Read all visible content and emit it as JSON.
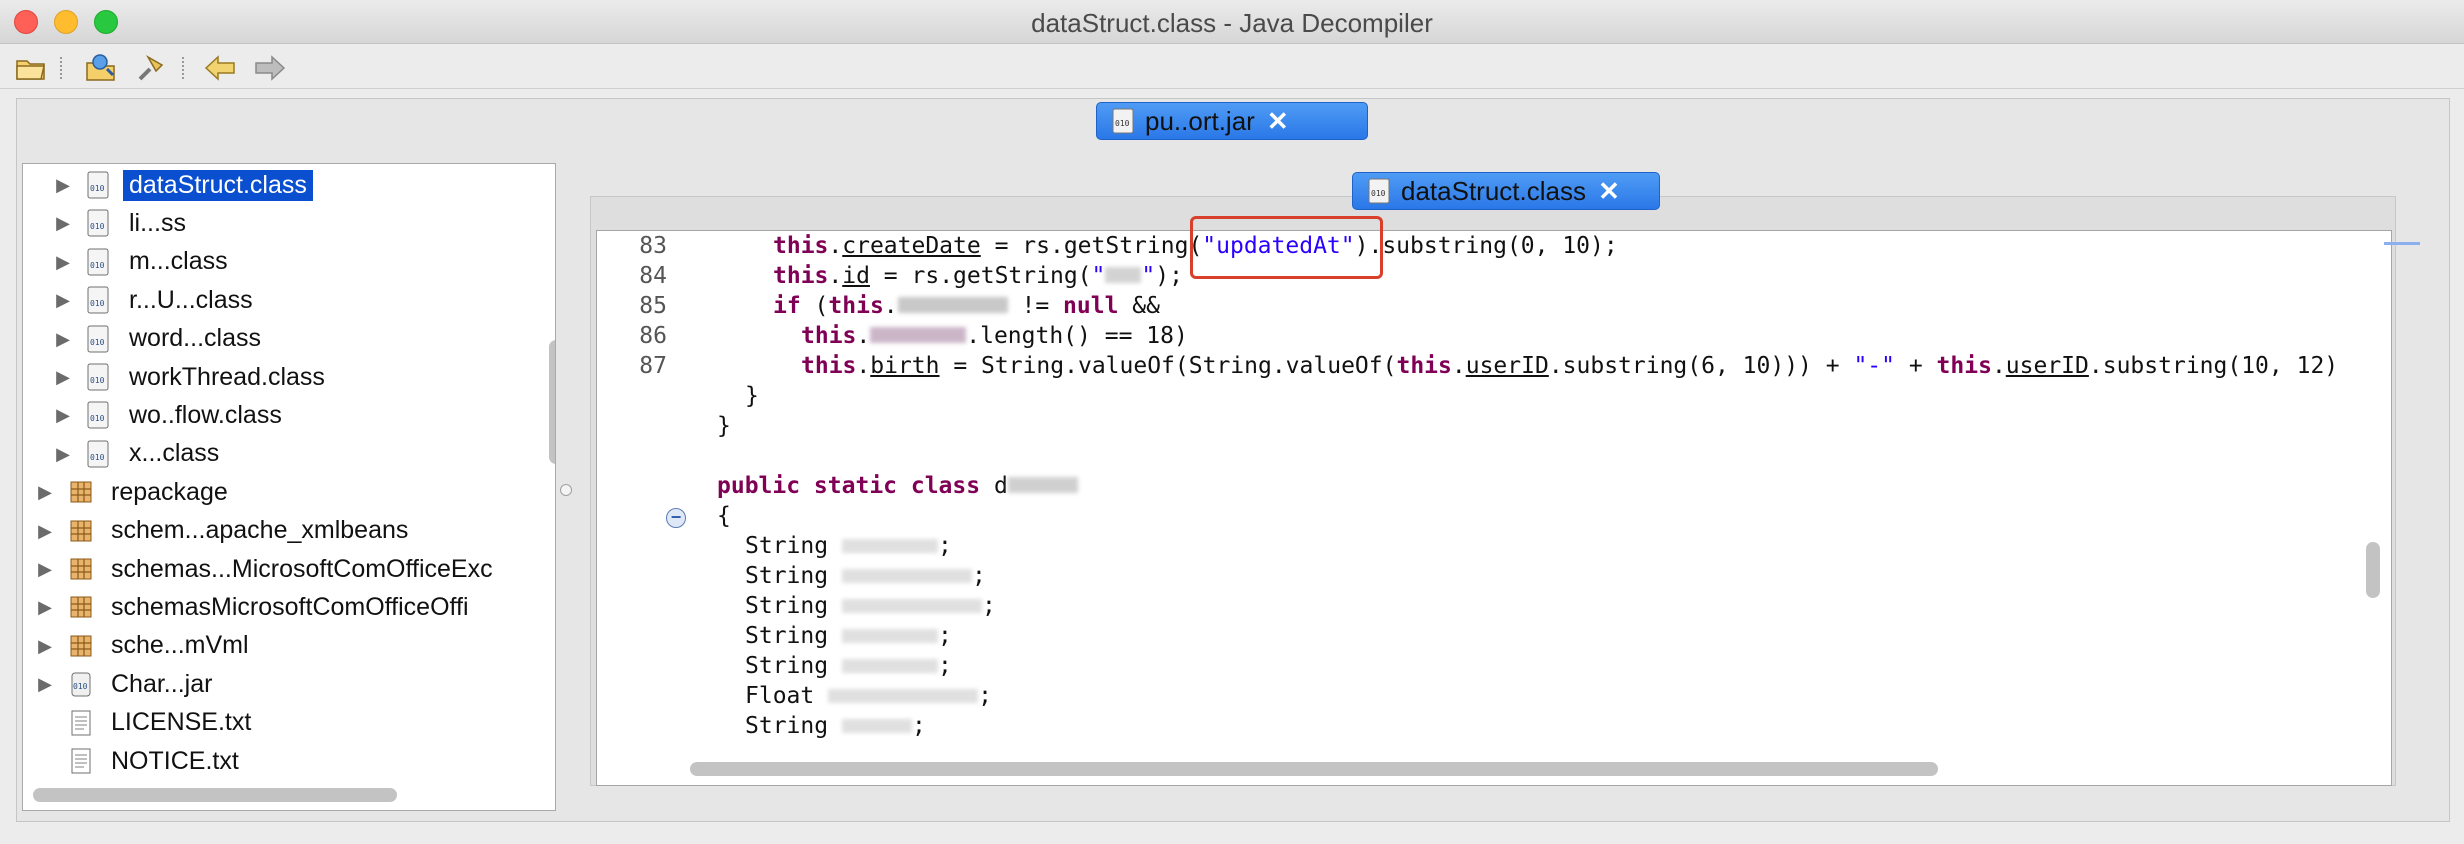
{
  "window": {
    "title": "dataStruct.class - Java Decompiler"
  },
  "toolbar": {
    "buttons": [
      {
        "name": "open-file-icon"
      },
      {
        "name": "open-type-icon"
      },
      {
        "name": "search-icon"
      },
      {
        "name": "back-arrow-icon"
      },
      {
        "name": "forward-arrow-icon"
      }
    ]
  },
  "tabs": {
    "jar_tab_label": "pu..ort.jar",
    "class_tab_label": "dataStruct.class"
  },
  "tree": {
    "items": [
      {
        "label": "dataStruct.class",
        "icon": "class-file-icon",
        "selected": true
      },
      {
        "label": "li...ss",
        "icon": "class-file-icon"
      },
      {
        "label": "m...class",
        "icon": "class-file-icon"
      },
      {
        "label": "r...U...class",
        "icon": "class-file-icon"
      },
      {
        "label": "word...class",
        "icon": "class-file-icon"
      },
      {
        "label": "workThread.class",
        "icon": "class-file-icon"
      },
      {
        "label": "wo..flow.class",
        "icon": "class-file-icon"
      },
      {
        "label": "x...class",
        "icon": "class-file-icon"
      },
      {
        "label": "repackage",
        "icon": "package-icon"
      },
      {
        "label": "schem...apache_xmlbeans",
        "icon": "package-icon"
      },
      {
        "label": "schemas...MicrosoftComOfficeExc",
        "icon": "package-icon"
      },
      {
        "label": "schemasMicrosoftComOfficeOffi",
        "icon": "package-icon"
      },
      {
        "label": "sche...mVml",
        "icon": "package-icon"
      },
      {
        "label": "Char...jar",
        "icon": "jar-icon"
      },
      {
        "label": "LICENSE.txt",
        "icon": "text-file-icon"
      },
      {
        "label": "NOTICE.txt",
        "icon": "text-file-icon"
      }
    ]
  },
  "editor": {
    "line_numbers": [
      "83",
      "84",
      "85",
      "86",
      "87"
    ],
    "highlighted_string": "\"updatedAt\""
  },
  "colors": {
    "accent": "#2a78e8",
    "selection": "#0a4fd0",
    "keyword": "#7f0055",
    "string": "#2a00ff",
    "highlight_box": "#d9402b"
  }
}
